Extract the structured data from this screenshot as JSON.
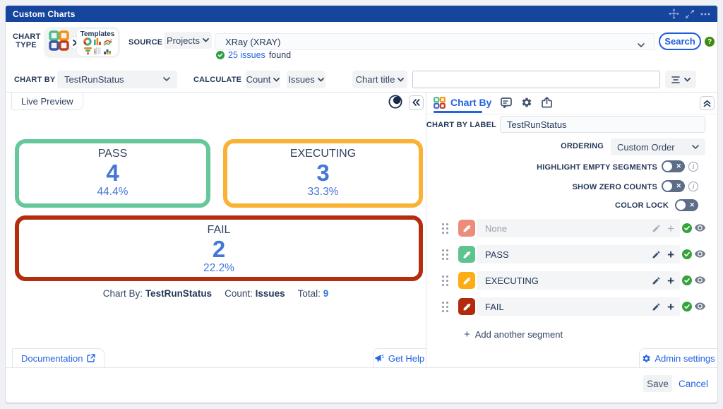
{
  "titlebar": {
    "title": "Custom Charts"
  },
  "config": {
    "chart_type_label_line1": "CHART",
    "chart_type_label_line2": "TYPE",
    "templates_label": "Templates",
    "source_label": "SOURCE",
    "source_type_value": "Projects",
    "source_value": "XRay (XRAY)",
    "issues_found_count": "25 issues",
    "issues_found_suffix": "found",
    "search_label": "Search",
    "help_glyph": "?",
    "chart_by_label": "CHART BY",
    "chart_by_value": "TestRunStatus",
    "calculate_label": "CALCULATE",
    "calculate_value": "Count",
    "calculate_unit": "Issues",
    "chart_title_label": "Chart title",
    "chart_title_value": "",
    "chart_title_placeholder": ""
  },
  "preview": {
    "tab": "Live Preview",
    "caption_chart_by_label": "Chart By:",
    "caption_chart_by_value": "TestRunStatus",
    "caption_count_label": "Count:",
    "caption_count_value": "Issues",
    "caption_total_label": "Total:",
    "caption_total_value": "9",
    "documentation_label": "Documentation",
    "get_help_label": "Get Help"
  },
  "chart_data": {
    "type": "tile",
    "title": "",
    "categories": [
      "PASS",
      "EXECUTING",
      "FAIL"
    ],
    "values": [
      4,
      3,
      2
    ],
    "percentages": [
      "44.4%",
      "33.3%",
      "22.2%"
    ],
    "colors": [
      "#64C89B",
      "#F9B233",
      "#B42D0D"
    ],
    "total": 9,
    "chart_by": "TestRunStatus",
    "count_unit": "Issues"
  },
  "panel": {
    "tab": "Chart By",
    "chart_by_label_field_label": "CHART BY LABEL",
    "chart_by_label_field_value": "TestRunStatus",
    "ordering_label": "ORDERING",
    "ordering_value": "Custom Order",
    "highlight_empty_label": "HIGHLIGHT EMPTY SEGMENTS",
    "show_zero_label": "SHOW ZERO COUNTS",
    "color_lock_label": "COLOR LOCK",
    "toggle_x_glyph": "✕",
    "segments": [
      {
        "label": "None",
        "color": "#EC8D79",
        "muted": true
      },
      {
        "label": "PASS",
        "color": "#5EC48E",
        "muted": false
      },
      {
        "label": "EXECUTING",
        "color": "#FFAB13",
        "muted": false
      },
      {
        "label": "FAIL",
        "color": "#B02B0C",
        "muted": false
      }
    ],
    "add_segment_label": "Add another segment",
    "admin_settings_label": "Admin settings"
  },
  "footer": {
    "save_label": "Save",
    "cancel_label": "Cancel"
  }
}
